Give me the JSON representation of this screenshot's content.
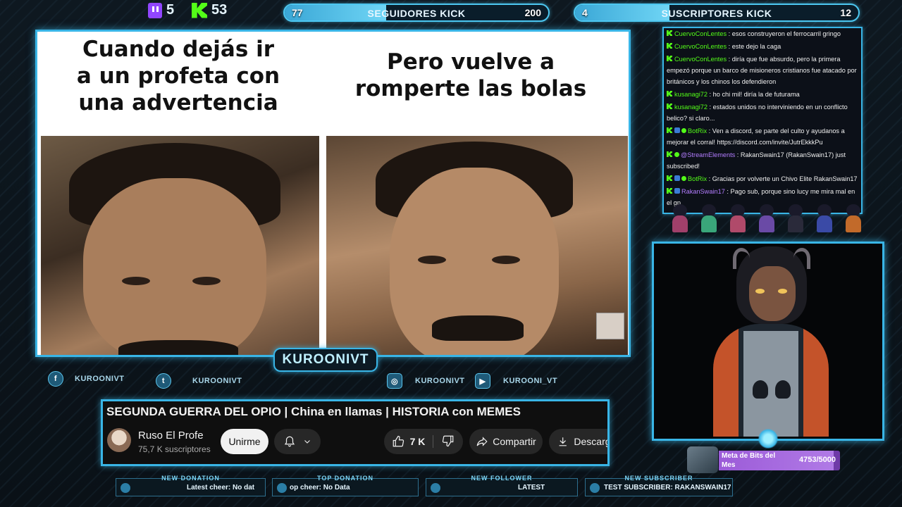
{
  "counters": {
    "twitch": "5",
    "kick": "53"
  },
  "goals": [
    {
      "title": "SEGUIDORES KICK",
      "current": "77",
      "target": "200",
      "progress": 0.385
    },
    {
      "title": "SUSCRIPTORES KICK",
      "current": "4",
      "target": "12",
      "progress": 0.333
    }
  ],
  "meme": {
    "left_caption": "Cuando dejás ir\na un profeta con\nuna advertencia",
    "right_caption": "Pero vuelve a\nromperte las bolas"
  },
  "brand": "KUROONIVT",
  "socials": [
    {
      "icon": "facebook-icon",
      "glyph": "f",
      "handle": "KUROONIVT"
    },
    {
      "icon": "twitter-icon",
      "glyph": "t",
      "handle": "KUROONIVT"
    },
    {
      "icon": "instagram-icon",
      "glyph": "◎",
      "handle": "KUROONIVT"
    },
    {
      "icon": "youtube-icon",
      "glyph": "▶",
      "handle": "KUROONI_VT"
    }
  ],
  "youtube": {
    "title": "SEGUNDA GUERRA DEL OPIO | China en llamas | HISTORIA con MEMES",
    "channel": "Ruso El Profe",
    "subscribers": "75,7 K suscriptores",
    "join": "Unirme",
    "likes": "7 K",
    "share": "Compartir",
    "download": "Descargar"
  },
  "chat": [
    {
      "user": "CuervoConLentes",
      "color": "#53fc18",
      "badges": [
        "k"
      ],
      "text": "esos construyeron el ferrocarril gringo"
    },
    {
      "user": "CuervoConLentes",
      "color": "#53fc18",
      "badges": [
        "k"
      ],
      "text": "este dejo la caga"
    },
    {
      "user": "CuervoConLentes",
      "color": "#53fc18",
      "badges": [
        "k"
      ],
      "text": "diría que fue absurdo, pero la primera empezó porque un barco de misioneros cristianos fue atacado por británicos y los chinos los defendieron"
    },
    {
      "user": "kusanagi72",
      "color": "#53fc18",
      "badges": [
        "k"
      ],
      "text": "ho chi mil! diría la de futurama"
    },
    {
      "user": "kusanagi72",
      "color": "#53fc18",
      "badges": [
        "k"
      ],
      "text": "estados unidos no interviniendo en un conflicto belico? si claro..."
    },
    {
      "user": "BotRix",
      "color": "#53fc18",
      "badges": [
        "k",
        "b",
        "g"
      ],
      "text": "Ven a discord, se parte del culto y ayudanos a mejorar el corral! https://discord.com/invite/JutrEkkkPu"
    },
    {
      "user": "@StreamElements",
      "color": "#b37dff",
      "badges": [
        "k",
        "g"
      ],
      "text": "RakanSwain17 (RakanSwain17) just subscribed!"
    },
    {
      "user": "BotRix",
      "color": "#53fc18",
      "badges": [
        "k",
        "b",
        "g"
      ],
      "text": "Gracias por volverte un Chivo Elite RakanSwain17"
    },
    {
      "user": "RakanSwain17",
      "color": "#b37dff",
      "badges": [
        "k",
        "b"
      ],
      "text": "Pago sub, porque sino lucy me mira mal en el gp"
    }
  ],
  "bits_goal": {
    "label": "Meta de Bits del Mes",
    "value": "4753/5000",
    "progress": 0.95
  },
  "alerts": [
    {
      "head": "NEW DONATION",
      "text": "Latest cheer: No dat"
    },
    {
      "head": "TOP DONATION",
      "text": "op cheer: No Data"
    },
    {
      "head": "NEW FOLLOWER",
      "text": "LATEST"
    },
    {
      "head": "NEW SUBSCRIBER",
      "text": "TEST SUBSCRIBER: RAKANSWAIN17"
    }
  ]
}
